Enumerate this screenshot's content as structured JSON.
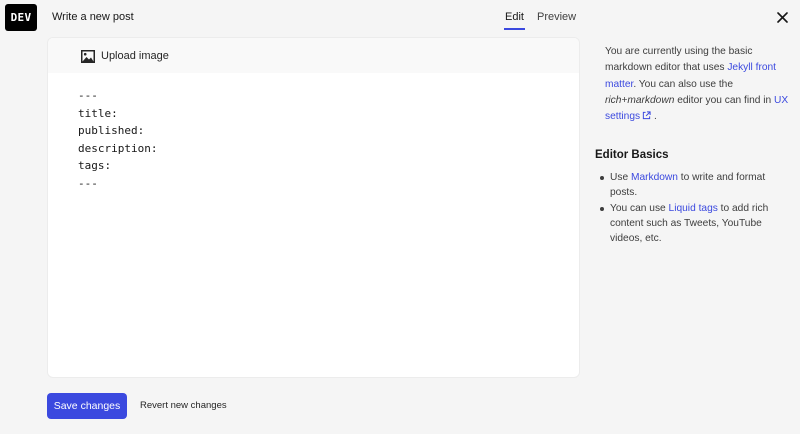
{
  "header": {
    "logo_text": "DEV",
    "page_title": "Write a new post",
    "tabs": [
      {
        "label": "Edit",
        "active": true
      },
      {
        "label": "Preview",
        "active": false
      }
    ],
    "close_icon": "close-icon"
  },
  "editor": {
    "toolbar": {
      "upload_label": "Upload image",
      "upload_icon": "image-icon"
    },
    "content": "---\ntitle: \npublished: \ndescription: \ntags: \n---"
  },
  "help": {
    "intro_1": "You are currently using the basic markdown editor that uses ",
    "jekyll_link": "Jekyll front matter",
    "intro_2": ". You can also use the ",
    "rich_markdown": "rich+markdown",
    "intro_3": " editor you can find in ",
    "ux_settings_link": "UX settings",
    "intro_4": " .",
    "basics_title": "Editor Basics",
    "basics": [
      {
        "pre": "Use ",
        "link": "Markdown",
        "post": " to write and format posts."
      },
      {
        "pre": "You can use ",
        "link": "Liquid tags",
        "post": " to add rich content such as Tweets, YouTube videos, etc."
      }
    ]
  },
  "footer": {
    "save_label": "Save changes",
    "revert_label": "Revert new changes"
  },
  "colors": {
    "accent": "#3b49df",
    "background": "#f5f5f5",
    "text": "#171717"
  }
}
